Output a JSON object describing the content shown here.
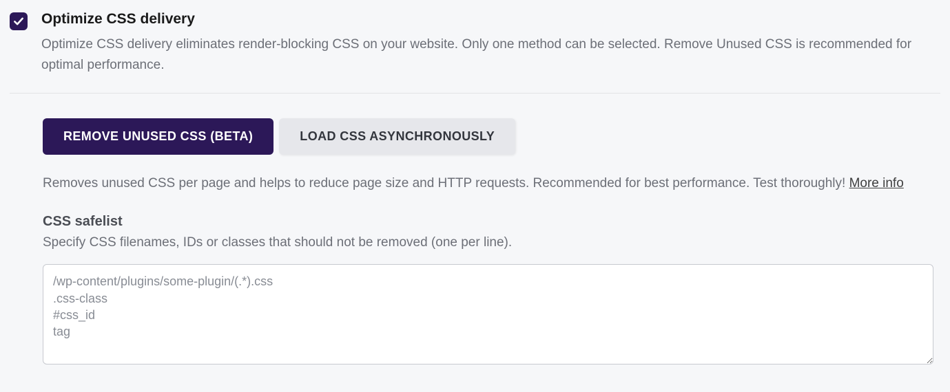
{
  "header": {
    "title": "Optimize CSS delivery",
    "description": "Optimize CSS delivery eliminates render-blocking CSS on your website. Only one method can be selected. Remove Unused CSS is recommended for optimal performance.",
    "checked": true
  },
  "tabs": {
    "remove_unused_label": "REMOVE UNUSED CSS (BETA)",
    "load_async_label": "LOAD CSS ASYNCHRONOUSLY"
  },
  "tab_description": "Removes unused CSS per page and helps to reduce page size and HTTP requests. Recommended for best performance. Test thoroughly! ",
  "more_info_label": "More info",
  "safelist": {
    "title": "CSS safelist",
    "description": "Specify CSS filenames, IDs or classes that should not be removed (one per line).",
    "placeholder": "/wp-content/plugins/some-plugin/(.*).css\n.css-class\n#css_id\ntag"
  }
}
